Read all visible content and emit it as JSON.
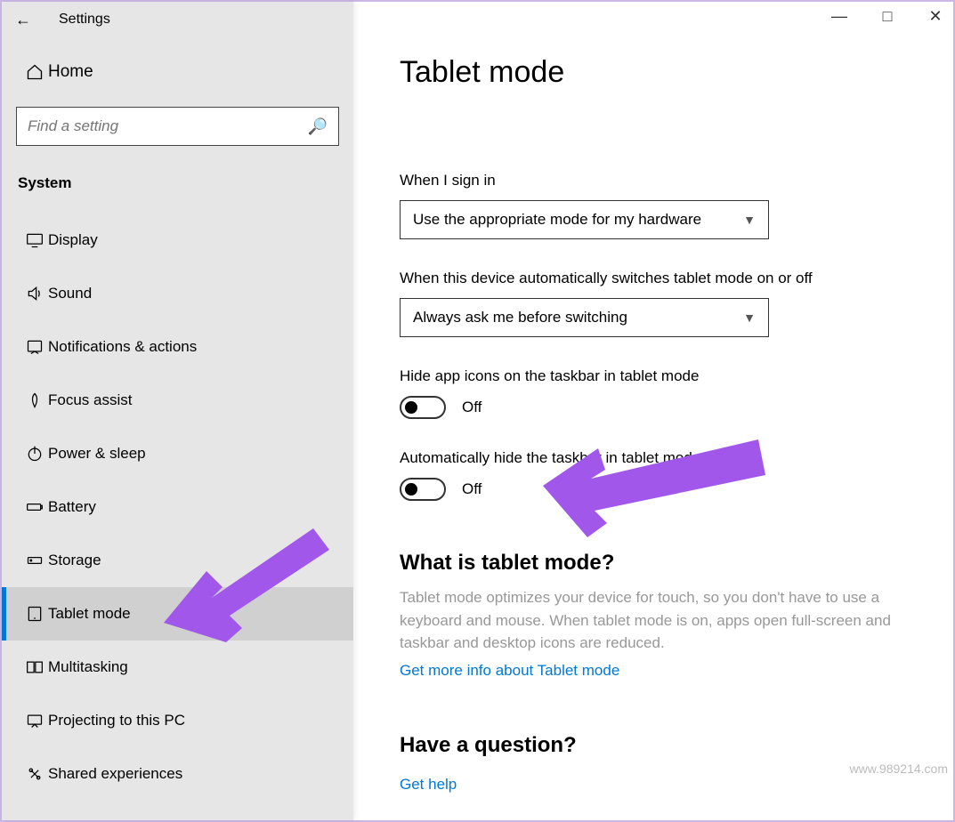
{
  "window": {
    "title": "Settings"
  },
  "sidebar": {
    "home_label": "Home",
    "search_placeholder": "Find a setting",
    "category": "System",
    "items": [
      {
        "label": "Display",
        "active": false
      },
      {
        "label": "Sound",
        "active": false
      },
      {
        "label": "Notifications & actions",
        "active": false
      },
      {
        "label": "Focus assist",
        "active": false
      },
      {
        "label": "Power & sleep",
        "active": false
      },
      {
        "label": "Battery",
        "active": false
      },
      {
        "label": "Storage",
        "active": false
      },
      {
        "label": "Tablet mode",
        "active": true
      },
      {
        "label": "Multitasking",
        "active": false
      },
      {
        "label": "Projecting to this PC",
        "active": false
      },
      {
        "label": "Shared experiences",
        "active": false
      }
    ]
  },
  "main": {
    "title": "Tablet mode",
    "sign_in": {
      "label": "When I sign in",
      "value": "Use the appropriate mode for my hardware"
    },
    "switch": {
      "label": "When this device automatically switches tablet mode on or off",
      "value": "Always ask me before switching"
    },
    "hide_icons": {
      "label": "Hide app icons on the taskbar in tablet mode",
      "state": "Off"
    },
    "hide_taskbar": {
      "label": "Automatically hide the taskbar in tablet mode",
      "state": "Off"
    },
    "what_heading": "What is tablet mode?",
    "what_desc": "Tablet mode optimizes your device for touch, so you don't have to use a keyboard and mouse. When tablet mode is on, apps open full-screen and taskbar and desktop icons are reduced.",
    "what_link": "Get more info about Tablet mode",
    "question_heading": "Have a question?",
    "question_link": "Get help"
  },
  "watermark": "www.989214.com"
}
